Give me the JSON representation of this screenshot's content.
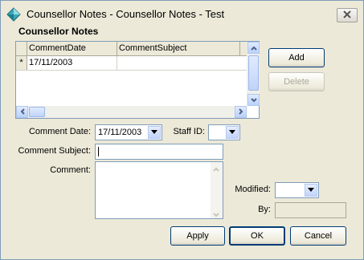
{
  "window": {
    "title": "Counsellor Notes - Counsellor Notes - Test"
  },
  "section_title": "Counsellor Notes",
  "grid": {
    "columns": [
      "CommentDate",
      "CommentSubject"
    ],
    "new_row_marker": "*",
    "rows": [
      {
        "CommentDate": "17/11/2003",
        "CommentSubject": ""
      }
    ]
  },
  "buttons": {
    "add": "Add",
    "delete": "Delete",
    "apply": "Apply",
    "ok": "OK",
    "cancel": "Cancel"
  },
  "form": {
    "comment_date_label": "Comment Date:",
    "comment_date_value": "17/11/2003",
    "staff_id_label": "Staff ID:",
    "staff_id_value": "",
    "comment_subject_label": "Comment Subject:",
    "comment_subject_value": "",
    "comment_label": "Comment:",
    "comment_value": "",
    "modified_label": "Modified:",
    "modified_value": "",
    "by_label": "By:",
    "by_value": ""
  },
  "icons": {
    "app": "diamond-app-icon",
    "close": "close-icon"
  }
}
